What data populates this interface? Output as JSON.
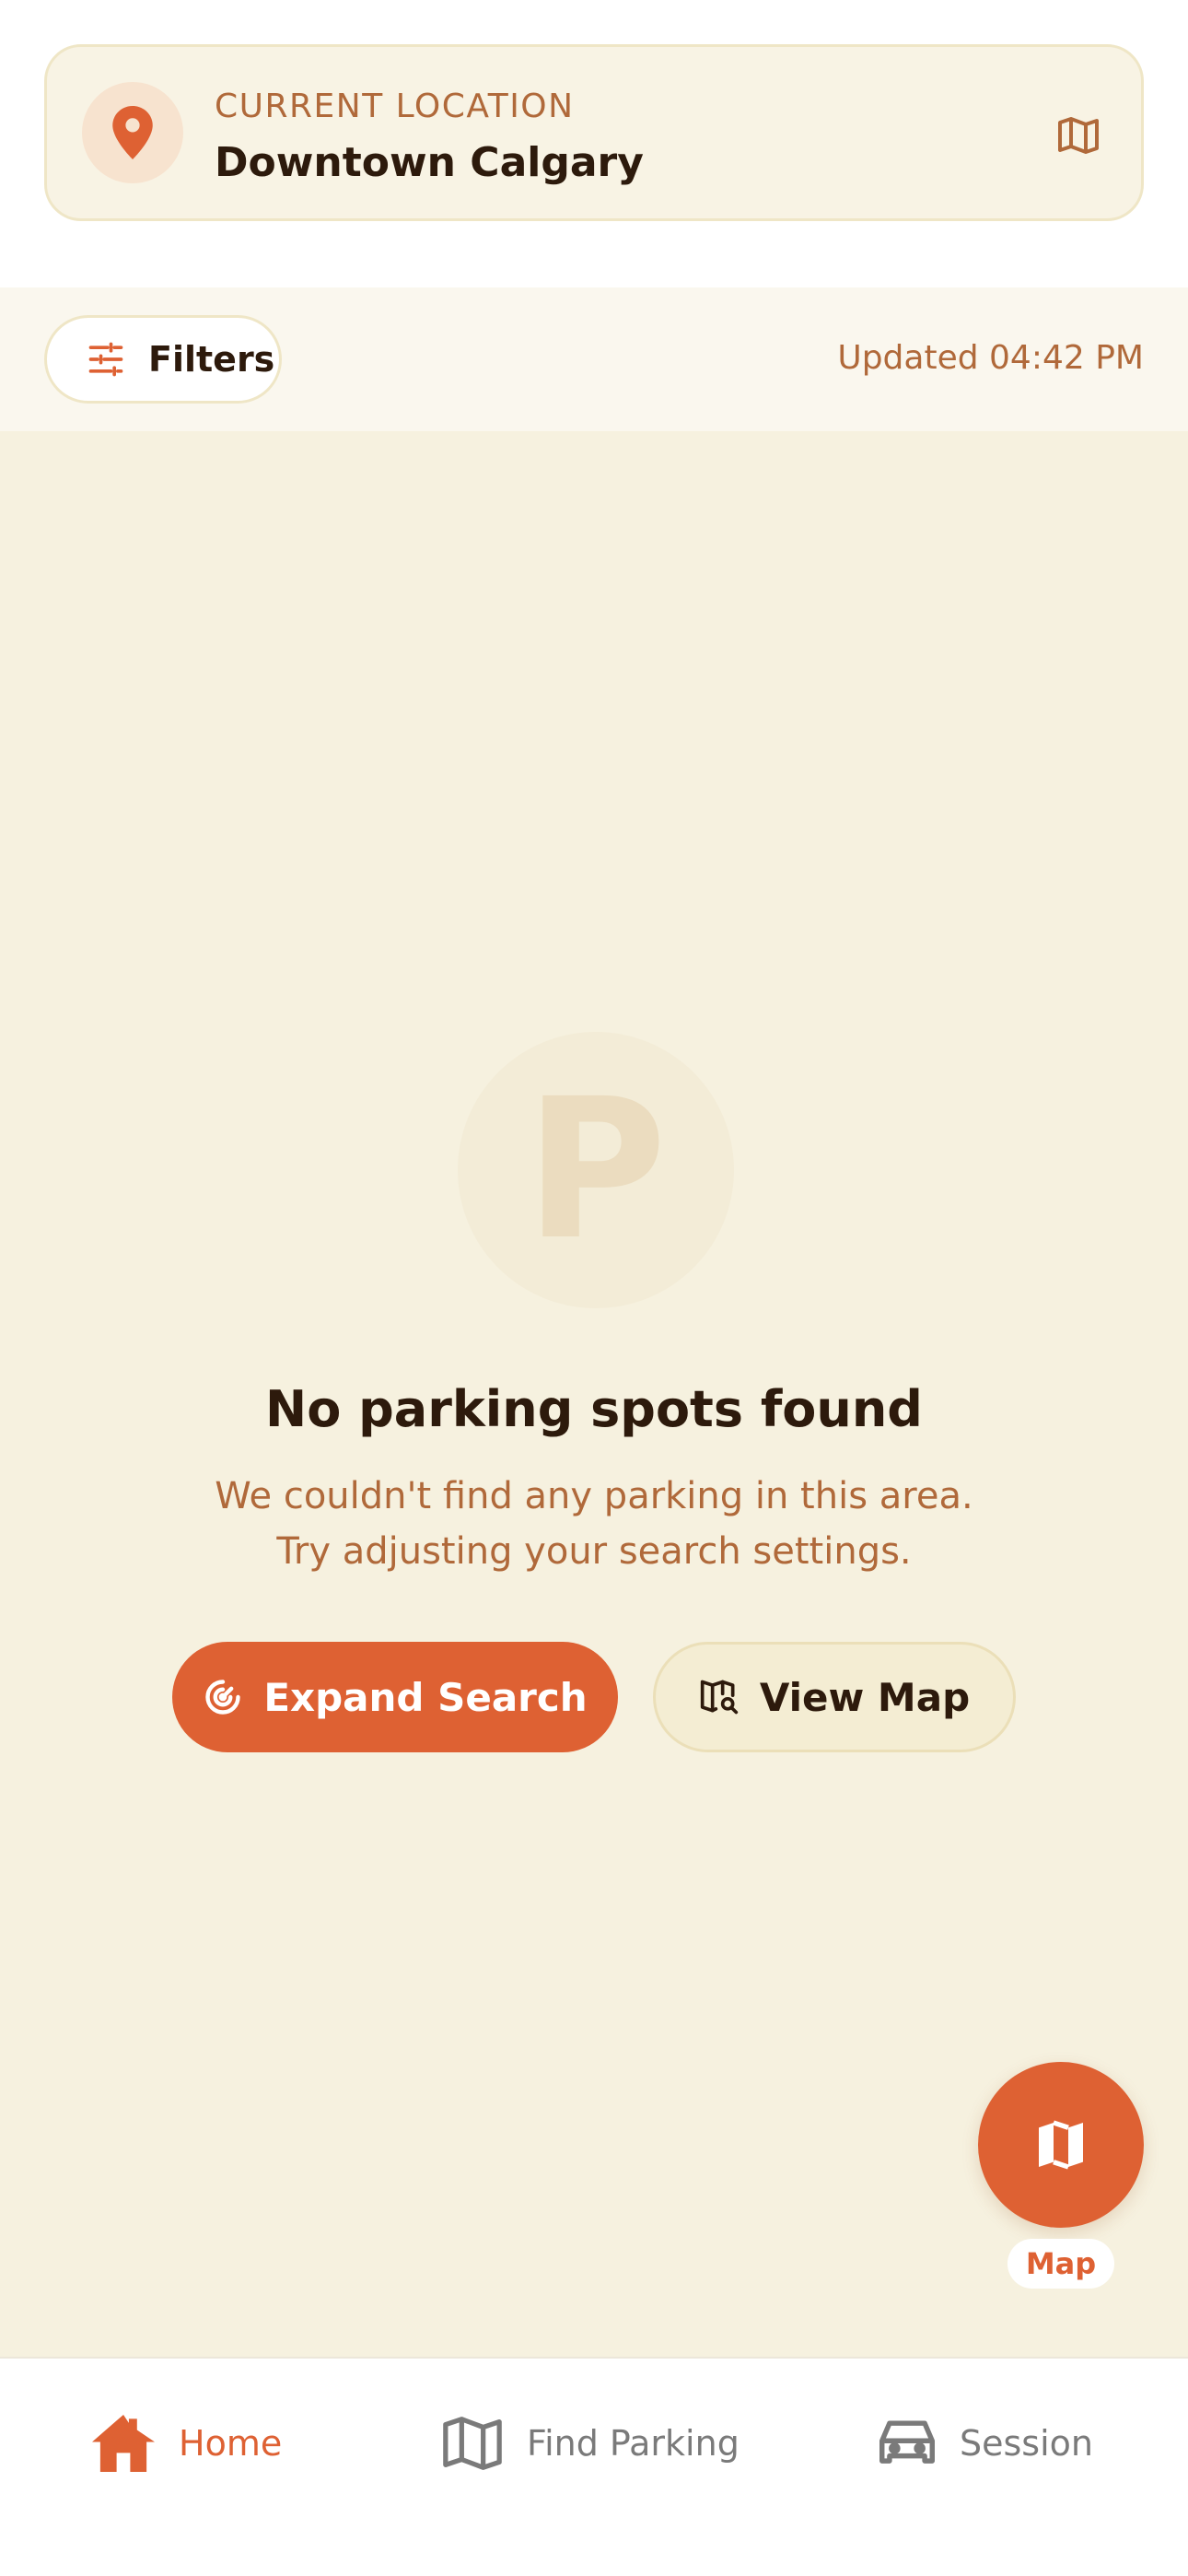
{
  "location": {
    "label": "CURRENT LOCATION",
    "value": "Downtown Calgary",
    "pin_icon": "map-pin-icon",
    "map_icon": "map-icon"
  },
  "filter_bar": {
    "filters_label": "Filters",
    "updated_text": "Updated 04:42 PM"
  },
  "empty_state": {
    "icon_letter": "P",
    "title": "No parking spots found",
    "description_line1": "We couldn't find any parking in this area.",
    "description_line2": "Try adjusting your search settings.",
    "expand_label": "Expand Search",
    "view_map_label": "View Map"
  },
  "fab": {
    "label": "Map",
    "icon": "map-icon"
  },
  "nav": {
    "items": [
      {
        "label": "Home",
        "icon": "home-icon",
        "active": true
      },
      {
        "label": "Find Parking",
        "icon": "map-icon",
        "active": false
      },
      {
        "label": "Session",
        "icon": "car-icon",
        "active": false
      }
    ]
  },
  "colors": {
    "accent": "#de6133",
    "accent_text": "#b0693a",
    "dark_text": "#2d1a0c",
    "background": "#f6f1df",
    "inactive": "#7a7a7a"
  }
}
